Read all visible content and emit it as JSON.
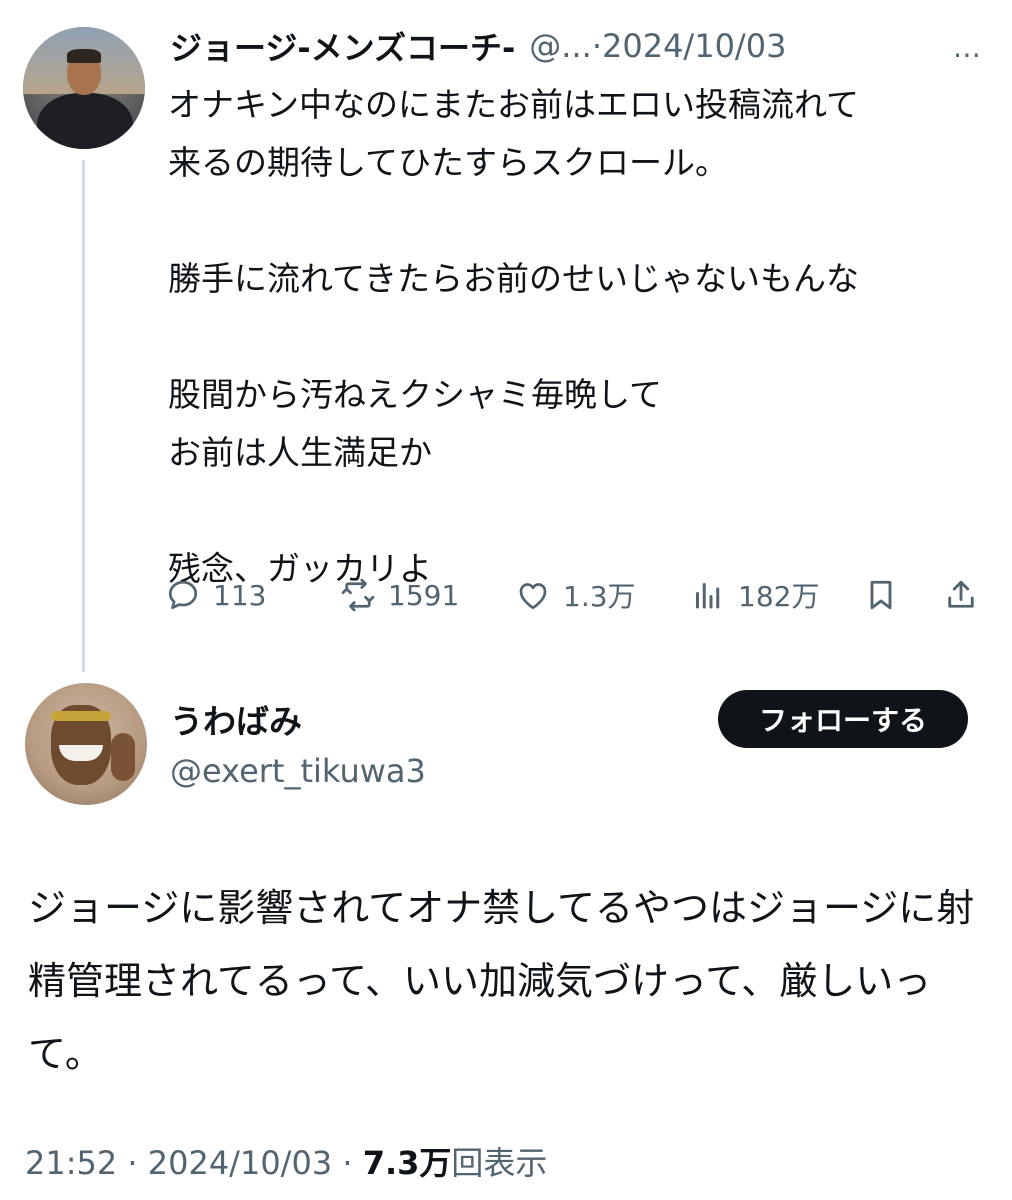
{
  "parent": {
    "display_name": "ジョージ-メンズコーチ-",
    "handle_short": "@...",
    "separator": " · ",
    "date": "2024/10/03",
    "more_icon": "⋯",
    "text": "オナキン中なのにまたお前はエロい投稿流れて\n来るの期待してひたすらスクロール。\n\n勝手に流れてきたらお前のせいじゃないもんな\n\n股間から汚ねえクシャミ毎晩して\nお前は人生満足か\n\n残念、ガッカリよ",
    "replies": "113",
    "reposts": "1591",
    "likes": "1.3万",
    "views": "182万"
  },
  "reply": {
    "display_name": "うわばみ",
    "handle": "@exert_tikuwa3",
    "follow_label": "フォローする",
    "text": "ジョージに影響されてオナ禁してるやつはジョージに射精管理されてるって、いい加減気づけって、厳しいって。",
    "time": "21:52",
    "date": "2024/10/03",
    "views_count": "7.3万",
    "views_label": "回表示"
  },
  "colors": {
    "text": "#0f1419",
    "secondary": "#536471",
    "thread_line": "#cfd9de",
    "button_bg": "#0f1419"
  }
}
